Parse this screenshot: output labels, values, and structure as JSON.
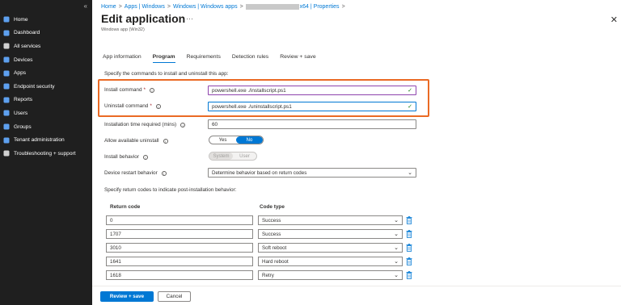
{
  "sidebar": {
    "collapse_glyph": "«",
    "items": [
      {
        "label": "Home",
        "icon": "home-icon",
        "color": "#5ea0ef"
      },
      {
        "label": "Dashboard",
        "icon": "dashboard-icon",
        "color": "#5ea0ef"
      },
      {
        "label": "All services",
        "icon": "list-icon",
        "color": "#d0d0d0"
      },
      {
        "label": "Devices",
        "icon": "devices-icon",
        "color": "#5ea0ef"
      },
      {
        "label": "Apps",
        "icon": "apps-icon",
        "color": "#5ea0ef"
      },
      {
        "label": "Endpoint security",
        "icon": "shield-icon",
        "color": "#5ea0ef"
      },
      {
        "label": "Reports",
        "icon": "reports-icon",
        "color": "#5ea0ef"
      },
      {
        "label": "Users",
        "icon": "user-icon",
        "color": "#5ea0ef"
      },
      {
        "label": "Groups",
        "icon": "groups-icon",
        "color": "#5ea0ef"
      },
      {
        "label": "Tenant administration",
        "icon": "tenant-icon",
        "color": "#5ea0ef"
      },
      {
        "label": "Troubleshooting + support",
        "icon": "wrench-icon",
        "color": "#d0d0d0"
      }
    ]
  },
  "breadcrumb": {
    "items": [
      "Home",
      "Apps | Windows",
      "Windows | Windows apps"
    ],
    "last": "x64 | Properties",
    "separator": ">"
  },
  "header": {
    "title": "Edit application",
    "dots": "···",
    "subtitle": "Windows app (Win32)",
    "close": "✕"
  },
  "tabs": [
    "App information",
    "Program",
    "Requirements",
    "Detection rules",
    "Review + save"
  ],
  "form": {
    "intro": "Specify the commands to install and uninstall this app:",
    "install_label": "Install command",
    "install_value": "powershell.exe ./installscript.ps1",
    "uninstall_label": "Uninstall command",
    "uninstall_value": "powershell.exe ./uninstallscript.ps1",
    "required_mark": "*",
    "info_glyph": "i",
    "check_glyph": "✓",
    "time_label": "Installation time required (mins)",
    "time_value": "60",
    "allow_label": "Allow available uninstall",
    "allow_yes": "Yes",
    "allow_no": "No",
    "behavior_label": "Install behavior",
    "behavior_system": "System",
    "behavior_user": "User",
    "restart_label": "Device restart behavior",
    "restart_value": "Determine behavior based on return codes",
    "return_intro": "Specify return codes to indicate post-installation behavior:",
    "col_return": "Return code",
    "col_type": "Code type",
    "chevron": "⌄"
  },
  "return_codes": [
    {
      "code": "0",
      "type": "Success"
    },
    {
      "code": "1707",
      "type": "Success"
    },
    {
      "code": "3010",
      "type": "Soft reboot"
    },
    {
      "code": "1641",
      "type": "Hard reboot"
    },
    {
      "code": "1618",
      "type": "Retry"
    }
  ],
  "footer": {
    "primary": "Review + save",
    "secondary": "Cancel"
  },
  "colors": {
    "accent": "#0078d4",
    "highlight": "#ea6a24",
    "sidebar_bg": "#1f1f1f"
  }
}
